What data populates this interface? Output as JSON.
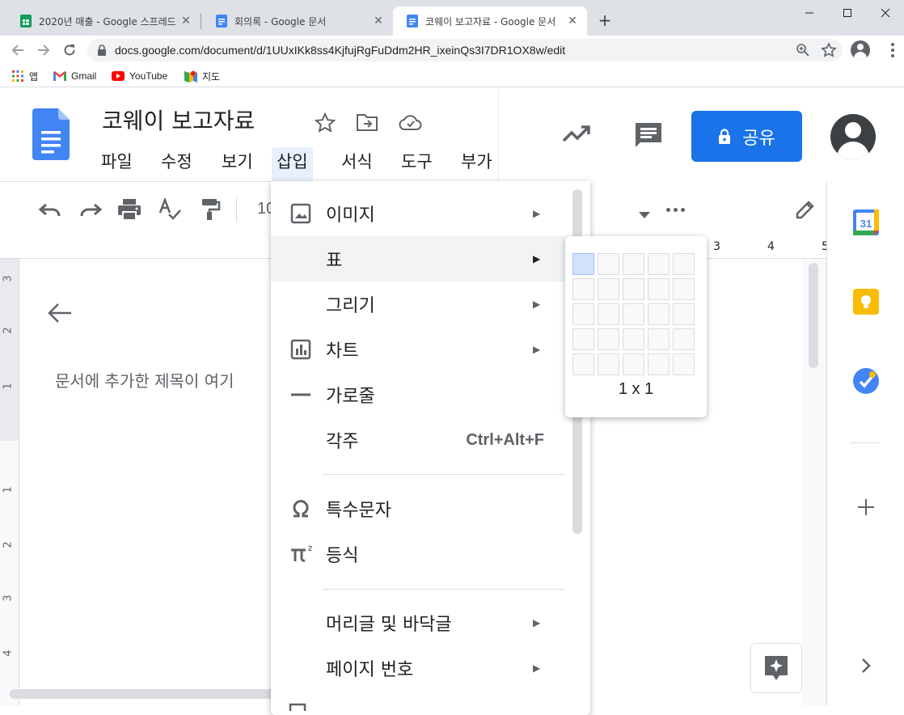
{
  "browser": {
    "tabs": [
      {
        "title": "2020년 매출 - Google 스프레드",
        "icon": "sheets-icon"
      },
      {
        "title": "회의록 - Google 문서",
        "icon": "docs-icon"
      },
      {
        "title": "코웨이 보고자료 - Google 문서",
        "icon": "docs-icon"
      }
    ],
    "new_tab": "+",
    "url": "docs.google.com/document/d/1UUxIKk8ss4KjfujRgFuDdm2HR_ixeinQs3I7DR1OX8w/edit",
    "bookmarks": [
      {
        "label": "앱",
        "icon": "apps-grid-icon"
      },
      {
        "label": "Gmail",
        "icon": "gmail-icon"
      },
      {
        "label": "YouTube",
        "icon": "youtube-icon"
      },
      {
        "label": "지도",
        "icon": "maps-icon"
      }
    ]
  },
  "docs": {
    "title": "코웨이 보고자료",
    "menu": [
      "파일",
      "수정",
      "보기",
      "삽입",
      "서식",
      "도구",
      "부가"
    ],
    "share_label": "공유",
    "toolbar_font_size": "10",
    "outline_text": "문서에 추가한 제목이 여기",
    "ruler_h": [
      "3",
      "4",
      "5"
    ],
    "ruler_v": [
      "3",
      "2",
      "1",
      "1",
      "2",
      "3",
      "4"
    ]
  },
  "insert_menu": {
    "items": [
      {
        "label": "이미지",
        "icon": "image-icon",
        "arrow": "▶"
      },
      {
        "label": "표",
        "icon": "",
        "arrow": "▶"
      },
      {
        "label": "그리기",
        "icon": "",
        "arrow": "▶"
      },
      {
        "label": "차트",
        "icon": "chart-icon",
        "arrow": "▶"
      },
      {
        "label": "가로줄",
        "icon": "horizontal-line-icon",
        "arrow": ""
      },
      {
        "label": "각주",
        "icon": "",
        "shortcut": "Ctrl+Alt+F"
      },
      {
        "label": "특수문자",
        "icon": "omega-icon",
        "arrow": ""
      },
      {
        "label": "등식",
        "icon": "pi-icon",
        "arrow": ""
      },
      {
        "label": "머리글 및 바닥글",
        "icon": "",
        "arrow": "▶"
      },
      {
        "label": "페이지 번호",
        "icon": "",
        "arrow": "▶"
      }
    ]
  },
  "table_grid": {
    "rows": 5,
    "cols": 5,
    "selected": "1 x 1"
  },
  "colors": {
    "accent": "#1a73e8",
    "docs_blue": "#4285f4",
    "menu_open_bg": "#e8f0fe"
  }
}
